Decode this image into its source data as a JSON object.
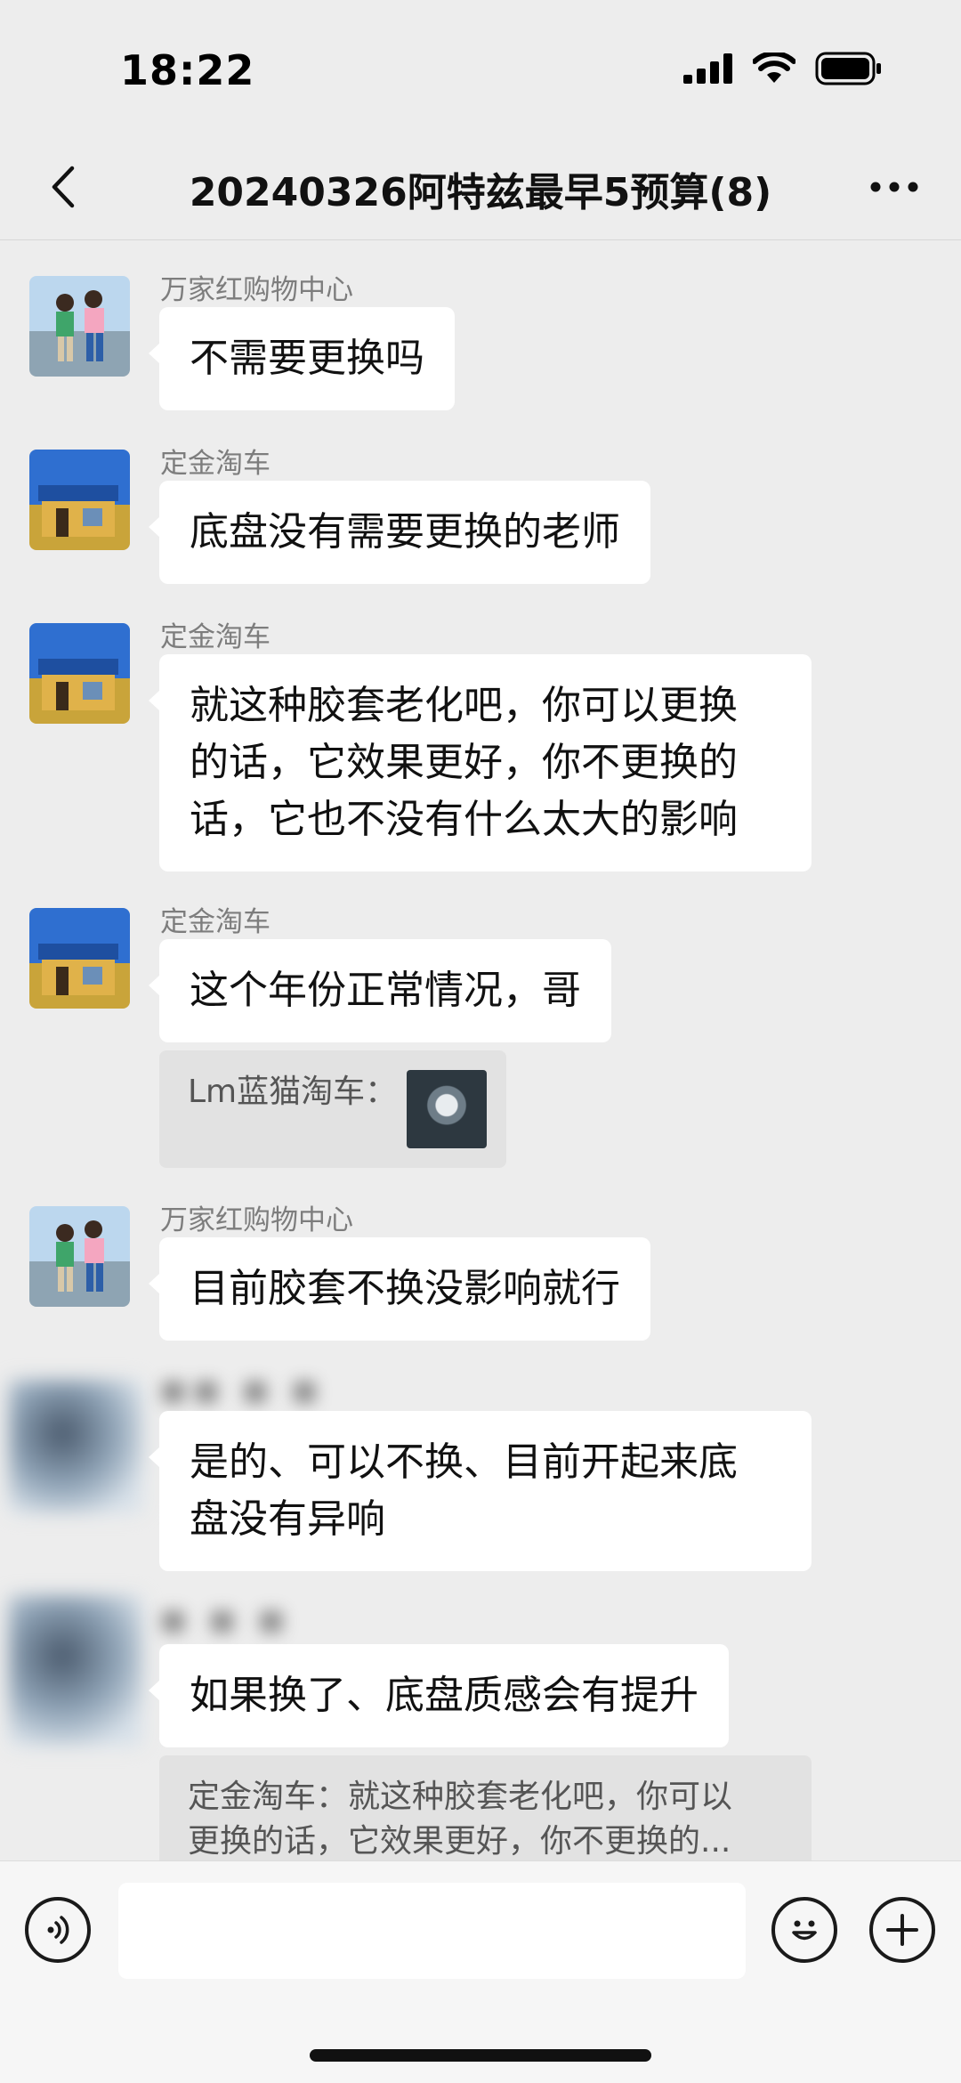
{
  "status_bar": {
    "time": "18:22"
  },
  "nav": {
    "title": "20240326阿特兹最早5预算(8)"
  },
  "messages": [
    {
      "sender": "万家红购物中心",
      "text": "不需要更换吗",
      "avatar": "kids-photo"
    },
    {
      "sender": "定金淘车",
      "text": "底盘没有需要更换的老师",
      "avatar": "shop-photo"
    },
    {
      "sender": "定金淘车",
      "lines": [
        "就这种胶套老化吧，你可以更换",
        "的话，它效果更好，你不更换的",
        "话，它也不没有什么太大的影响"
      ],
      "avatar": "shop-photo"
    },
    {
      "sender": "定金淘车",
      "text": "这个年份正常情况，哥",
      "avatar": "shop-photo",
      "quote": {
        "text": "Lm蓝猫淘车：",
        "has_image": true
      }
    },
    {
      "sender": "万家红购物中心",
      "text": "目前胶套不换没影响就行",
      "avatar": "kids-photo"
    },
    {
      "sender": "",
      "lines": [
        "是的、可以不换、目前开起来底",
        "盘没有异响"
      ],
      "avatar": "blurred"
    },
    {
      "sender": "",
      "text": "如果换了、底盘质感会有提升",
      "avatar": "blurred",
      "quote": {
        "lines": [
          "定金淘车：就这种胶套老化吧，你可以",
          "更换的话，它效果更好，你不更换的..."
        ]
      }
    }
  ],
  "input": {
    "placeholder": ""
  },
  "icons": {
    "back": "chevron-left-icon",
    "more": "more-dots-icon",
    "voice": "voice-icon",
    "emoji": "emoji-icon",
    "plus": "plus-icon"
  }
}
